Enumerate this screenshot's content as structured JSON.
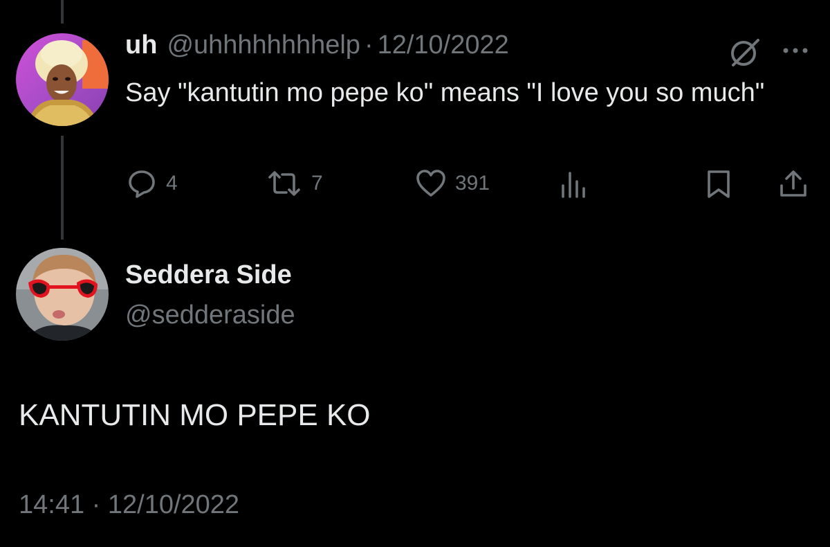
{
  "parent_tweet": {
    "name": "uh",
    "handle": "@uhhhhhhhhelp",
    "separator": "·",
    "date": "12/10/2022",
    "text": "Say \"kantutin mo pepe ko\" means \"I love you so much\"",
    "more_icon": "more-horizontal-icon",
    "grok_icon": "grok-icon",
    "stats": {
      "replies": "4",
      "reposts": "7",
      "likes": "391"
    },
    "icons": [
      "reply-icon",
      "repost-icon",
      "like-icon",
      "views-icon",
      "bookmark-icon",
      "share-icon"
    ]
  },
  "reply_tweet": {
    "name": "Seddera Side",
    "handle": "@sedderaside",
    "text": "KANTUTIN MO PEPE KO",
    "time": "14:41",
    "separator": "·",
    "date": "12/10/2022"
  },
  "colors": {
    "background": "#000000",
    "primary_text": "#e7e9ea",
    "secondary_text": "#71767b",
    "thread_line": "#333639"
  }
}
